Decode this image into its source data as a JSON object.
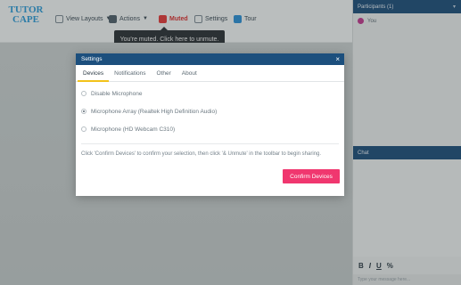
{
  "app": {
    "logo_line1": "TUTOR",
    "logo_line2": "CAPE"
  },
  "toolbar": {
    "view_label": "View Layouts",
    "actions_label": "Actions",
    "muted_label": "Muted",
    "settings_label": "Settings",
    "tour_label": "Tour"
  },
  "tooltip": {
    "text": "You're muted. Click here to unmute."
  },
  "sidebar": {
    "participants_title": "Participants (1)",
    "participant_name": "You",
    "chat_title": "Chat",
    "chat_tools": [
      "B",
      "I",
      "U",
      "%"
    ],
    "chat_placeholder": "Type your message here..."
  },
  "modal": {
    "title": "Settings",
    "close_glyph": "×",
    "tabs": [
      {
        "label": "Devices",
        "active": true
      },
      {
        "label": "Notifications",
        "active": false
      },
      {
        "label": "Other",
        "active": false
      },
      {
        "label": "About",
        "active": false
      }
    ],
    "options": [
      {
        "label": "Disable Microphone",
        "selected": false
      },
      {
        "label": "Microphone Array (Realtek High Definition Audio)",
        "selected": true
      },
      {
        "label": "Microphone (HD Webcam C310)",
        "selected": false
      }
    ],
    "hint": "Click 'Confirm Devices' to confirm your selection, then click '& Unmute' in the toolbar to begin sharing.",
    "confirm_label": "Confirm Devices"
  },
  "colors": {
    "header_blue": "#1c4f7d",
    "accent_pink": "#f0376f",
    "tab_underline": "#f2c21b",
    "muted_red": "#d93030"
  }
}
